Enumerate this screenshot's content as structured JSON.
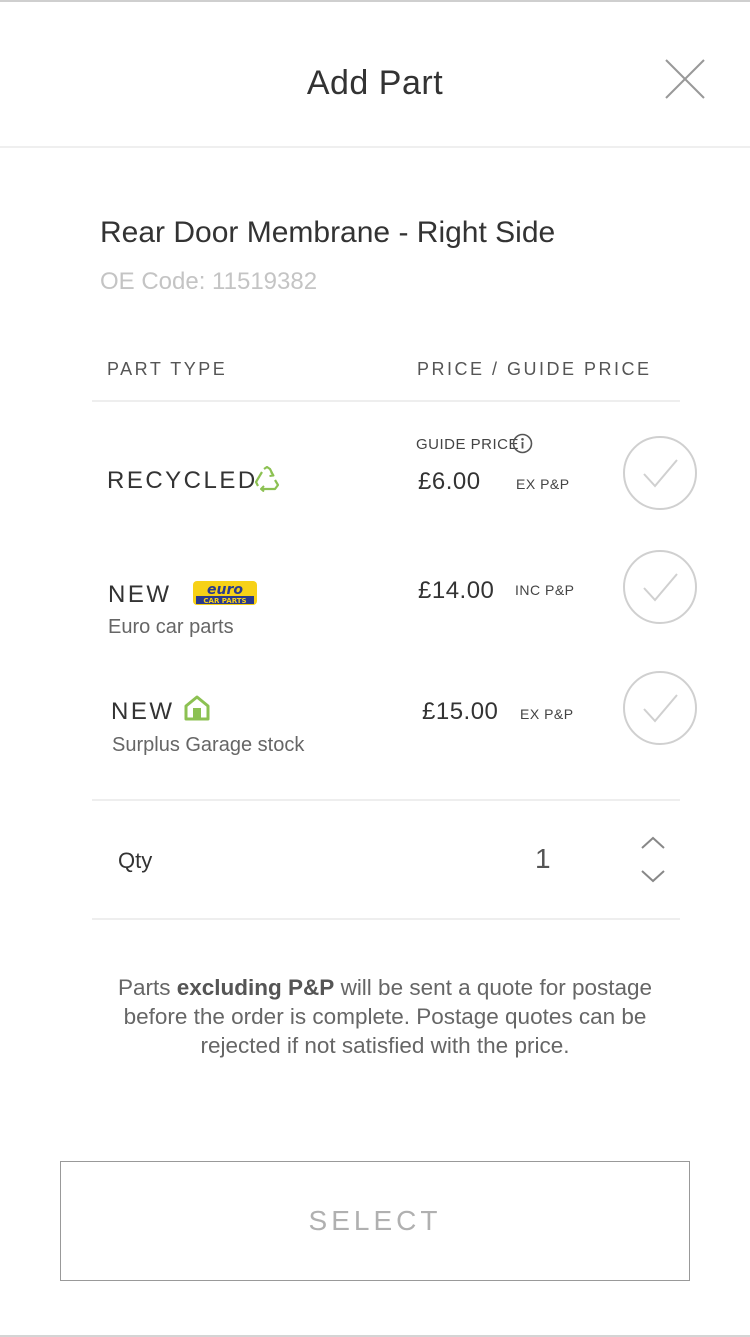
{
  "header": {
    "title": "Add Part"
  },
  "part": {
    "name": "Rear Door Membrane - Right Side",
    "oe_code": "OE Code: 11519382"
  },
  "columns": {
    "part_type": "PART TYPE",
    "price": "PRICE / GUIDE PRICE"
  },
  "options": [
    {
      "type": "RECYCLED",
      "icon": "recycle-icon",
      "guide_label": "GUIDE PRICE",
      "price": "£6.00",
      "pp": "EX P&P"
    },
    {
      "type": "NEW",
      "icon": "euro-car-parts-logo",
      "logo_text_1": "euro",
      "logo_text_2": "CAR PARTS",
      "sub": "Euro car parts",
      "price": "£14.00",
      "pp": "INC P&P"
    },
    {
      "type": "NEW",
      "icon": "garage-icon",
      "sub": "Surplus Garage stock",
      "price": "£15.00",
      "pp": "EX P&P"
    }
  ],
  "qty": {
    "label": "Qty",
    "value": "1"
  },
  "note": {
    "part1": "Parts ",
    "bold": "excluding P&P",
    "part2": " will be sent a quote for postage before the order is complete. Postage quotes can be rejected if not satisfied with the price."
  },
  "select_button": "SELECT",
  "colors": {
    "accent_green": "#8cc152",
    "check_gray": "#d0d0d0",
    "logo_yellow": "#f7d117",
    "logo_blue": "#2a3a8c"
  }
}
